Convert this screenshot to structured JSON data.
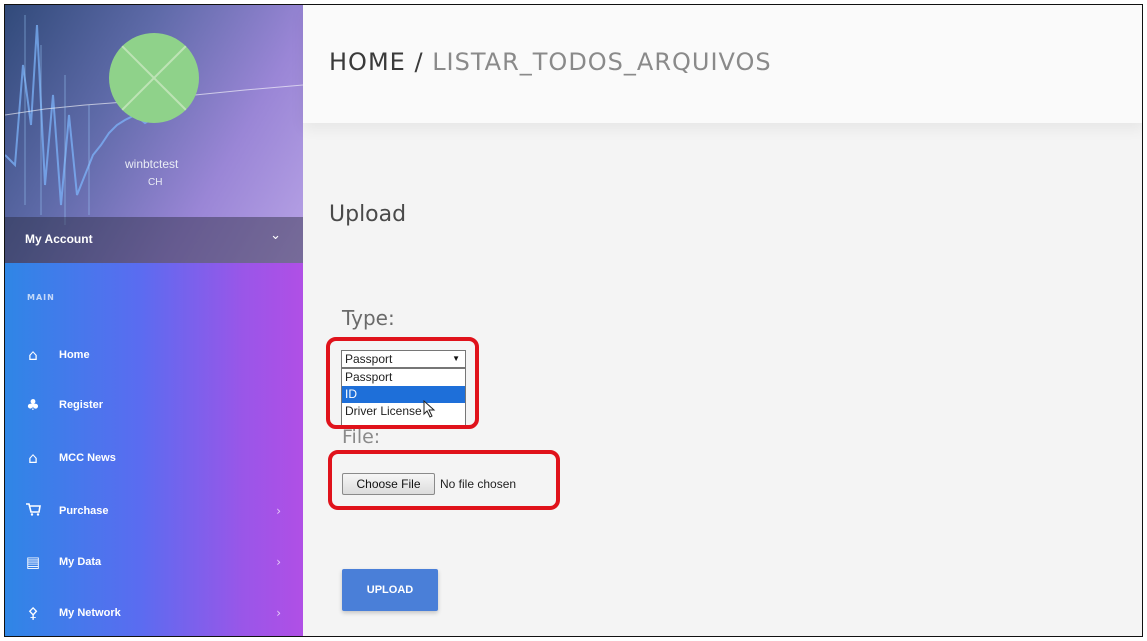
{
  "sidebar": {
    "username": "winbtctest",
    "user_code": "CH",
    "account_label": "My Account",
    "account_chevron_icon": "chevron-down-icon",
    "section_label": "MAIN",
    "items": [
      {
        "label": "Home",
        "icon": "home-icon",
        "glyph": "⌂",
        "has_arrow": false
      },
      {
        "label": "Register",
        "icon": "register-user-icon",
        "glyph": "♣",
        "has_arrow": false
      },
      {
        "label": "MCC News",
        "icon": "home-icon",
        "glyph": "⌂",
        "has_arrow": false
      },
      {
        "label": "Purchase",
        "icon": "cart-icon",
        "glyph": "⌂",
        "has_arrow": true
      },
      {
        "label": "My Data",
        "icon": "clipboard-icon",
        "glyph": "▤",
        "has_arrow": true
      },
      {
        "label": "My Network",
        "icon": "network-icon",
        "glyph": "⚴",
        "has_arrow": true
      }
    ],
    "arrow_glyph": "›"
  },
  "header": {
    "home": "HOME",
    "separator": "/",
    "current": "LISTAR_TODOS_ARQUIVOS"
  },
  "main": {
    "title": "Upload",
    "type_label": "Type:",
    "select_value": "Passport",
    "select_options": [
      "Passport",
      "ID",
      "Driver License"
    ],
    "highlighted_option": "ID",
    "file_label": "File:",
    "file_button_label": "Choose File",
    "file_status": "No file chosen",
    "upload_button_label": "UPLOAD"
  },
  "colors": {
    "highlight": "#e0121b",
    "upload_button": "#4a7fd8",
    "menu_gradient_start": "#2f86e6",
    "menu_gradient_end": "#b04fe6"
  }
}
